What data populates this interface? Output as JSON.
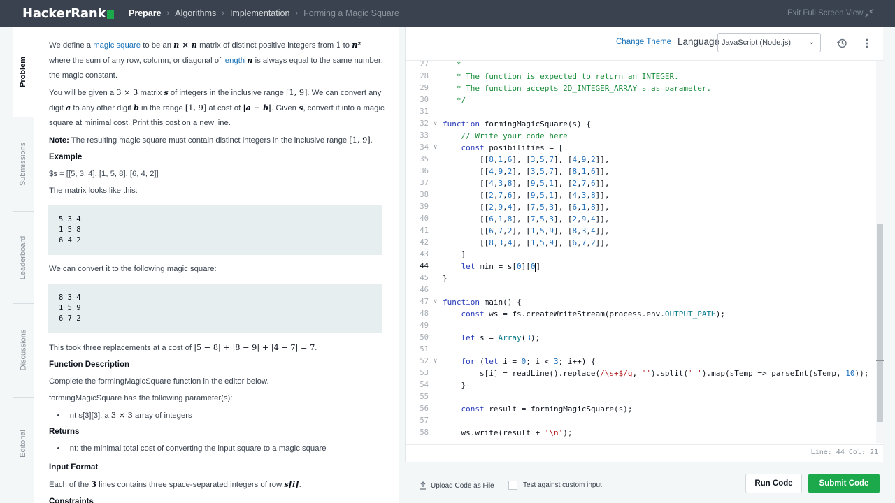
{
  "nav": {
    "logo": "HackerRank",
    "breadcrumbs": [
      "Prepare",
      "Algorithms",
      "Implementation",
      "Forming a Magic Square"
    ],
    "exit_fullscreen": "Exit Full Screen View"
  },
  "sidetabs": [
    "Problem",
    "Submissions",
    "Leaderboard",
    "Discussions",
    "Editorial"
  ],
  "problem": {
    "p1_a": "We define a ",
    "p1_link": "magic square",
    "p1_b": " to be an ",
    "p1_c": " matrix of distinct positive integers from ",
    "p1_d": " to ",
    "p1_e": " where the sum of any row, column, or diagonal of ",
    "p1_link2": "length",
    "p1_f": " is always equal to the same number: the magic constant.",
    "p2_a": "You will be given a ",
    "p2_b": " matrix ",
    "p2_c": " of integers in the inclusive range ",
    "p2_d": ". We can convert any digit ",
    "p2_e": " to any other digit ",
    "p2_f": " in the range ",
    "p2_g": " at cost of ",
    "p2_h": ". Given ",
    "p2_i": ", convert it into a magic square at minimal cost. Print this cost on a new line.",
    "note_label": "Note:",
    "note_text": " The resulting magic square must contain distinct integers in the inclusive range ",
    "example_heading": "Example",
    "example_s": "$s = [[5, 3, 4], [1, 5, 8], [6, 4, 2]]",
    "matrix_intro": "The matrix looks like this:",
    "matrix1": "5 3 4\n1 5 8\n6 4 2",
    "convert_intro": "We can convert it to the following magic square:",
    "matrix2": "8 3 4\n1 5 9\n6 7 2",
    "cost_text": "This took three replacements at a cost of ",
    "func_desc_heading": "Function Description",
    "func_desc": "Complete the formingMagicSquare function in the editor below.",
    "params_intro": "formingMagicSquare has the following parameter(s):",
    "param1_a": "int s[3][3]: a ",
    "param1_b": " array of integers",
    "returns_heading": "Returns",
    "returns1": "int: the minimal total cost of converting the input square to a magic square",
    "input_heading": "Input Format",
    "input_a": "Each of the ",
    "input_b": " lines contains three space-separated integers of row ",
    "constraints_heading": "Constraints",
    "m_n": "n",
    "m_nxn": "n × n",
    "m_1": "1",
    "m_n2": "n²",
    "m_3x3": "3 × 3",
    "m_s": "s",
    "m_range": "[1, 9]",
    "m_a": "a",
    "m_b": "b",
    "m_absab": "|a − b|",
    "m_cost": "|5 − 8| + |8 − 9| + |4 − 7| = 7",
    "m_3": "3",
    "m_si": "s[i]"
  },
  "editor": {
    "change_theme": "Change Theme",
    "language_label": "Language",
    "language_value": "JavaScript (Node.js)",
    "line_col": "Line: 44 Col: 21",
    "current_line": 44
  },
  "actions": {
    "upload": "Upload Code as File",
    "custom_input": "Test against custom input",
    "run": "Run Code",
    "submit": "Submit Code"
  }
}
